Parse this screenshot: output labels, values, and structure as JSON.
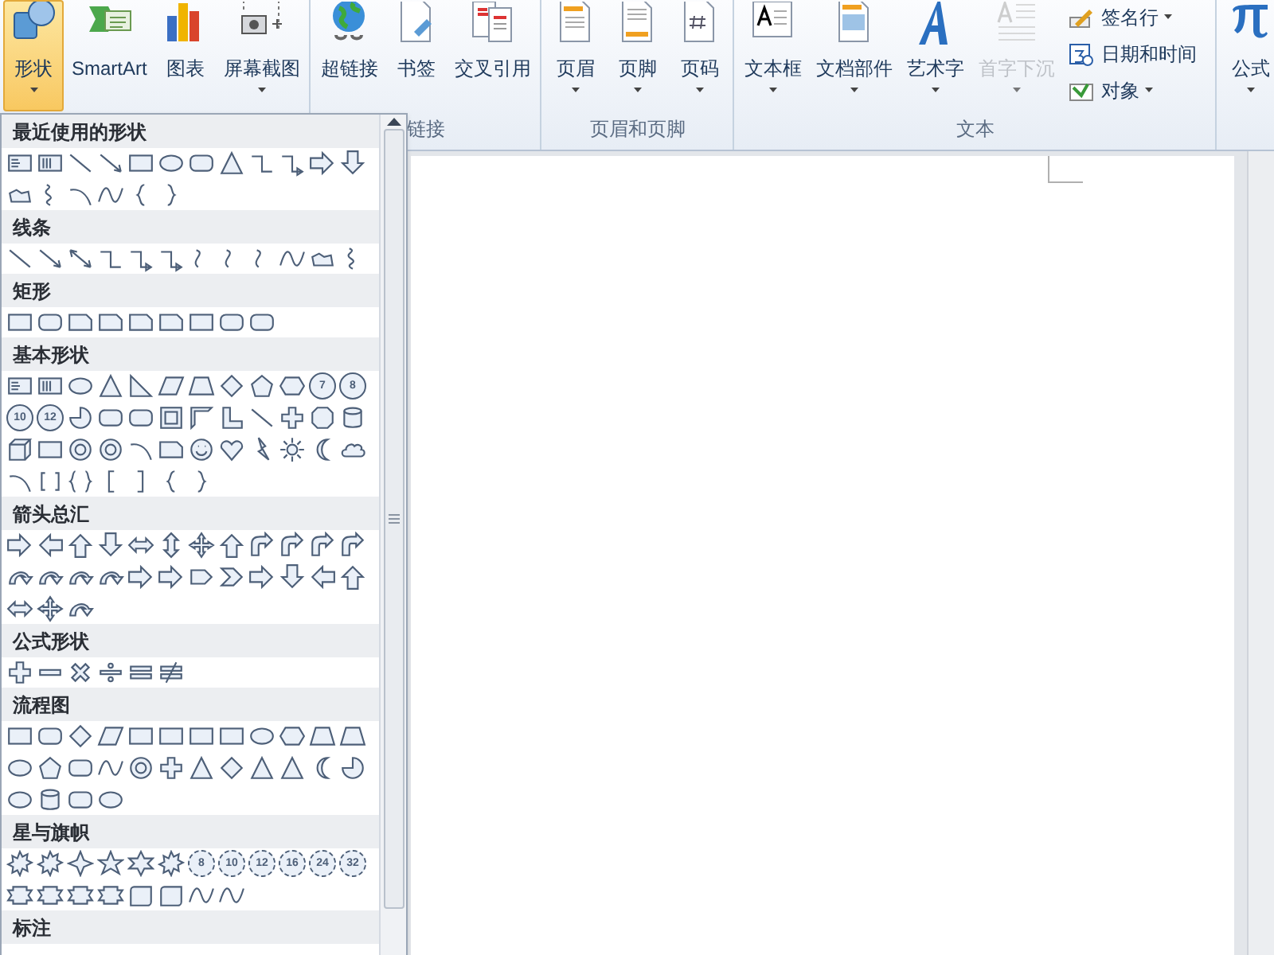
{
  "ribbon": {
    "groups": [
      {
        "buttons": [
          {
            "kind": "shapes",
            "label": "形状",
            "dropdown": true,
            "selected": true,
            "disabled": false
          },
          {
            "kind": "smartart",
            "label": "SmartArt",
            "dropdown": false,
            "selected": false,
            "disabled": false
          },
          {
            "kind": "chart",
            "label": "图表",
            "dropdown": false,
            "selected": false,
            "disabled": false
          },
          {
            "kind": "camera",
            "label": "屏幕截图",
            "dropdown": true,
            "selected": false,
            "disabled": false
          }
        ]
      },
      {
        "label": "链接",
        "buttons": [
          {
            "kind": "globe",
            "label": "超链接",
            "dropdown": false,
            "selected": false,
            "disabled": false
          },
          {
            "kind": "bookmark",
            "label": "书签",
            "dropdown": false,
            "selected": false,
            "disabled": false
          },
          {
            "kind": "crossref",
            "label": "交叉引用",
            "dropdown": false,
            "selected": false,
            "disabled": false
          }
        ]
      },
      {
        "label": "页眉和页脚",
        "buttons": [
          {
            "kind": "header",
            "label": "页眉",
            "dropdown": true,
            "selected": false,
            "disabled": false
          },
          {
            "kind": "footer",
            "label": "页脚",
            "dropdown": true,
            "selected": false,
            "disabled": false
          },
          {
            "kind": "pagenumber",
            "label": "页码",
            "dropdown": true,
            "selected": false,
            "disabled": false
          }
        ]
      },
      {
        "label": "文本",
        "buttons": [
          {
            "kind": "textbox",
            "label": "文本框",
            "dropdown": true,
            "selected": false,
            "disabled": false
          },
          {
            "kind": "quickparts",
            "label": "文档部件",
            "dropdown": true,
            "selected": false,
            "disabled": false
          },
          {
            "kind": "wordart",
            "label": "艺术字",
            "dropdown": true,
            "selected": false,
            "disabled": false
          },
          {
            "kind": "dropcap",
            "label": "首字下沉",
            "dropdown": true,
            "selected": false,
            "disabled": true
          }
        ],
        "small_buttons": [
          {
            "kind": "signature",
            "label": "签名行",
            "dropdown": true
          },
          {
            "kind": "calendar",
            "label": "日期和时间",
            "dropdown": false
          },
          {
            "kind": "object",
            "label": "对象",
            "dropdown": true
          }
        ]
      },
      {
        "buttons": [
          {
            "kind": "pi",
            "label": "公式",
            "dropdown": true,
            "selected": false,
            "disabled": false
          }
        ]
      }
    ]
  },
  "shapes_menu": {
    "categories": [
      {
        "title": "最近使用的形状",
        "shapes": [
          {
            "kind": "textbox"
          },
          {
            "kind": "vertical-textbox"
          },
          {
            "kind": "line"
          },
          {
            "kind": "arrow-line"
          },
          {
            "kind": "rect"
          },
          {
            "kind": "oval"
          },
          {
            "kind": "rounded-rect"
          },
          {
            "kind": "triangle"
          },
          {
            "kind": "elbow"
          },
          {
            "kind": "elbow-arrow"
          },
          {
            "kind": "arrow-right"
          },
          {
            "kind": "arrow-down"
          },
          {
            "kind": "freeform"
          },
          {
            "kind": "scribble"
          },
          {
            "kind": "arc"
          },
          {
            "kind": "wave"
          },
          {
            "kind": "brace-left"
          },
          {
            "kind": "brace-right"
          }
        ]
      },
      {
        "title": "线条",
        "shapes": [
          {
            "kind": "line"
          },
          {
            "kind": "arrow-line"
          },
          {
            "kind": "double-arrow-line"
          },
          {
            "kind": "elbow"
          },
          {
            "kind": "elbow-arrow"
          },
          {
            "kind": "elbow-arrow"
          },
          {
            "kind": "curve"
          },
          {
            "kind": "curve"
          },
          {
            "kind": "curve"
          },
          {
            "kind": "wave"
          },
          {
            "kind": "freeform"
          },
          {
            "kind": "scribble"
          }
        ]
      },
      {
        "title": "矩形",
        "shapes": [
          {
            "kind": "rect"
          },
          {
            "kind": "rounded-rect"
          },
          {
            "kind": "snip-rect"
          },
          {
            "kind": "snip-rect"
          },
          {
            "kind": "snip-rect"
          },
          {
            "kind": "snip-rect"
          },
          {
            "kind": "rect"
          },
          {
            "kind": "rounded-rect"
          },
          {
            "kind": "rounded-rect"
          }
        ]
      },
      {
        "title": "基本形状",
        "shapes": [
          {
            "kind": "textbox"
          },
          {
            "kind": "vertical-textbox"
          },
          {
            "kind": "oval"
          },
          {
            "kind": "triangle"
          },
          {
            "kind": "right-triangle"
          },
          {
            "kind": "parallelogram"
          },
          {
            "kind": "trapezoid"
          },
          {
            "kind": "diamond"
          },
          {
            "kind": "pentagon"
          },
          {
            "kind": "hexagon"
          },
          {
            "kind": "numbered-polygon",
            "label": "7"
          },
          {
            "kind": "numbered-polygon",
            "label": "8"
          },
          {
            "kind": "numbered-polygon",
            "label": "10"
          },
          {
            "kind": "numbered-polygon",
            "label": "12"
          },
          {
            "kind": "pie"
          },
          {
            "kind": "rounded-rect"
          },
          {
            "kind": "rounded-rect"
          },
          {
            "kind": "frame"
          },
          {
            "kind": "half-frame"
          },
          {
            "kind": "l-shape"
          },
          {
            "kind": "line"
          },
          {
            "kind": "cross"
          },
          {
            "kind": "octagon"
          },
          {
            "kind": "cylinder"
          },
          {
            "kind": "cube"
          },
          {
            "kind": "rect"
          },
          {
            "kind": "donut"
          },
          {
            "kind": "donut"
          },
          {
            "kind": "arc"
          },
          {
            "kind": "snip-rect"
          },
          {
            "kind": "smiley"
          },
          {
            "kind": "heart"
          },
          {
            "kind": "lightning"
          },
          {
            "kind": "sun"
          },
          {
            "kind": "moon"
          },
          {
            "kind": "cloud"
          },
          {
            "kind": "arc"
          },
          {
            "kind": "bracket-pair"
          },
          {
            "kind": "brace-pair"
          },
          {
            "kind": "bracket-left"
          },
          {
            "kind": "bracket-right"
          },
          {
            "kind": "brace-left"
          },
          {
            "kind": "brace-right"
          }
        ]
      },
      {
        "title": "箭头总汇",
        "shapes": [
          {
            "kind": "arrow-right"
          },
          {
            "kind": "arrow-left"
          },
          {
            "kind": "arrow-up"
          },
          {
            "kind": "arrow-down"
          },
          {
            "kind": "arrow-left-right"
          },
          {
            "kind": "arrow-up-down"
          },
          {
            "kind": "arrow-quad"
          },
          {
            "kind": "arrow-up"
          },
          {
            "kind": "bent-arrow"
          },
          {
            "kind": "bent-arrow"
          },
          {
            "kind": "bent-arrow"
          },
          {
            "kind": "bent-arrow"
          },
          {
            "kind": "curved-arrow"
          },
          {
            "kind": "curved-arrow"
          },
          {
            "kind": "curved-arrow"
          },
          {
            "kind": "curved-arrow"
          },
          {
            "kind": "arrow-right"
          },
          {
            "kind": "arrow-right"
          },
          {
            "kind": "pentagon-arrow"
          },
          {
            "kind": "chevron"
          },
          {
            "kind": "arrow-right"
          },
          {
            "kind": "arrow-down"
          },
          {
            "kind": "arrow-left"
          },
          {
            "kind": "arrow-up"
          },
          {
            "kind": "arrow-left-right"
          },
          {
            "kind": "arrow-quad"
          },
          {
            "kind": "curved-arrow"
          }
        ]
      },
      {
        "title": "公式形状",
        "shapes": [
          {
            "kind": "plus"
          },
          {
            "kind": "minus"
          },
          {
            "kind": "times"
          },
          {
            "kind": "divide"
          },
          {
            "kind": "equal"
          },
          {
            "kind": "not-equal"
          }
        ]
      },
      {
        "title": "流程图",
        "shapes": [
          {
            "kind": "rect"
          },
          {
            "kind": "rounded-rect"
          },
          {
            "kind": "diamond"
          },
          {
            "kind": "parallelogram"
          },
          {
            "kind": "rect"
          },
          {
            "kind": "rect"
          },
          {
            "kind": "rect"
          },
          {
            "kind": "rect"
          },
          {
            "kind": "oval"
          },
          {
            "kind": "hexagon"
          },
          {
            "kind": "trapezoid"
          },
          {
            "kind": "trapezoid"
          },
          {
            "kind": "oval"
          },
          {
            "kind": "pentagon"
          },
          {
            "kind": "rounded-rect"
          },
          {
            "kind": "wave"
          },
          {
            "kind": "donut"
          },
          {
            "kind": "cross"
          },
          {
            "kind": "triangle"
          },
          {
            "kind": "diamond"
          },
          {
            "kind": "triangle"
          },
          {
            "kind": "triangle"
          },
          {
            "kind": "moon"
          },
          {
            "kind": "pie"
          },
          {
            "kind": "oval"
          },
          {
            "kind": "cylinder"
          },
          {
            "kind": "rounded-rect"
          },
          {
            "kind": "oval"
          }
        ]
      },
      {
        "title": "星与旗帜",
        "shapes": [
          {
            "kind": "burst"
          },
          {
            "kind": "burst"
          },
          {
            "kind": "star4"
          },
          {
            "kind": "star"
          },
          {
            "kind": "star6"
          },
          {
            "kind": "burst"
          },
          {
            "kind": "numbered-star",
            "label": "8"
          },
          {
            "kind": "numbered-star",
            "label": "10"
          },
          {
            "kind": "numbered-star",
            "label": "12"
          },
          {
            "kind": "numbered-star",
            "label": "16"
          },
          {
            "kind": "numbered-star",
            "label": "24"
          },
          {
            "kind": "numbered-star",
            "label": "32"
          },
          {
            "kind": "ribbon"
          },
          {
            "kind": "ribbon"
          },
          {
            "kind": "ribbon"
          },
          {
            "kind": "ribbon"
          },
          {
            "kind": "scroll"
          },
          {
            "kind": "scroll"
          },
          {
            "kind": "wave"
          },
          {
            "kind": "wave"
          }
        ]
      },
      {
        "title": "标注"
      }
    ]
  }
}
